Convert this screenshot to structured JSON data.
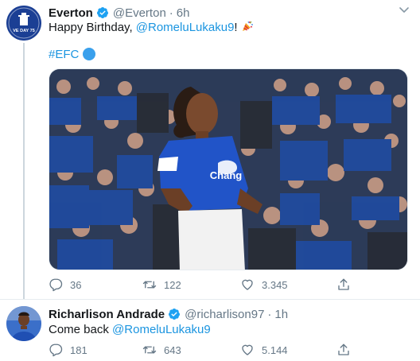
{
  "colors": {
    "accent": "#1b95e0",
    "text": "#14171a",
    "muted": "#657786",
    "verified": "#1da1f2",
    "line": "#ccd6dd"
  },
  "tweets": [
    {
      "author": "Everton",
      "handle": "@Everton",
      "time": "6h",
      "avatar_text": "VE DAY 75",
      "text_before": "Happy Birthday, ",
      "mention": "@RomeluLukaku9",
      "text_after": "! ",
      "emoji": "party-popper-icon",
      "hashtag": "#EFC",
      "shirt_sponsor": "Chang",
      "replies": "36",
      "retweets": "122",
      "likes": "3.345"
    },
    {
      "author": "Richarlison Andrade",
      "handle": "@richarlison97",
      "time": "1h",
      "text_before": "Come back ",
      "mention": "@RomeluLukaku9",
      "replies": "181",
      "retweets": "643",
      "likes": "5.144"
    }
  ],
  "separator": "·"
}
